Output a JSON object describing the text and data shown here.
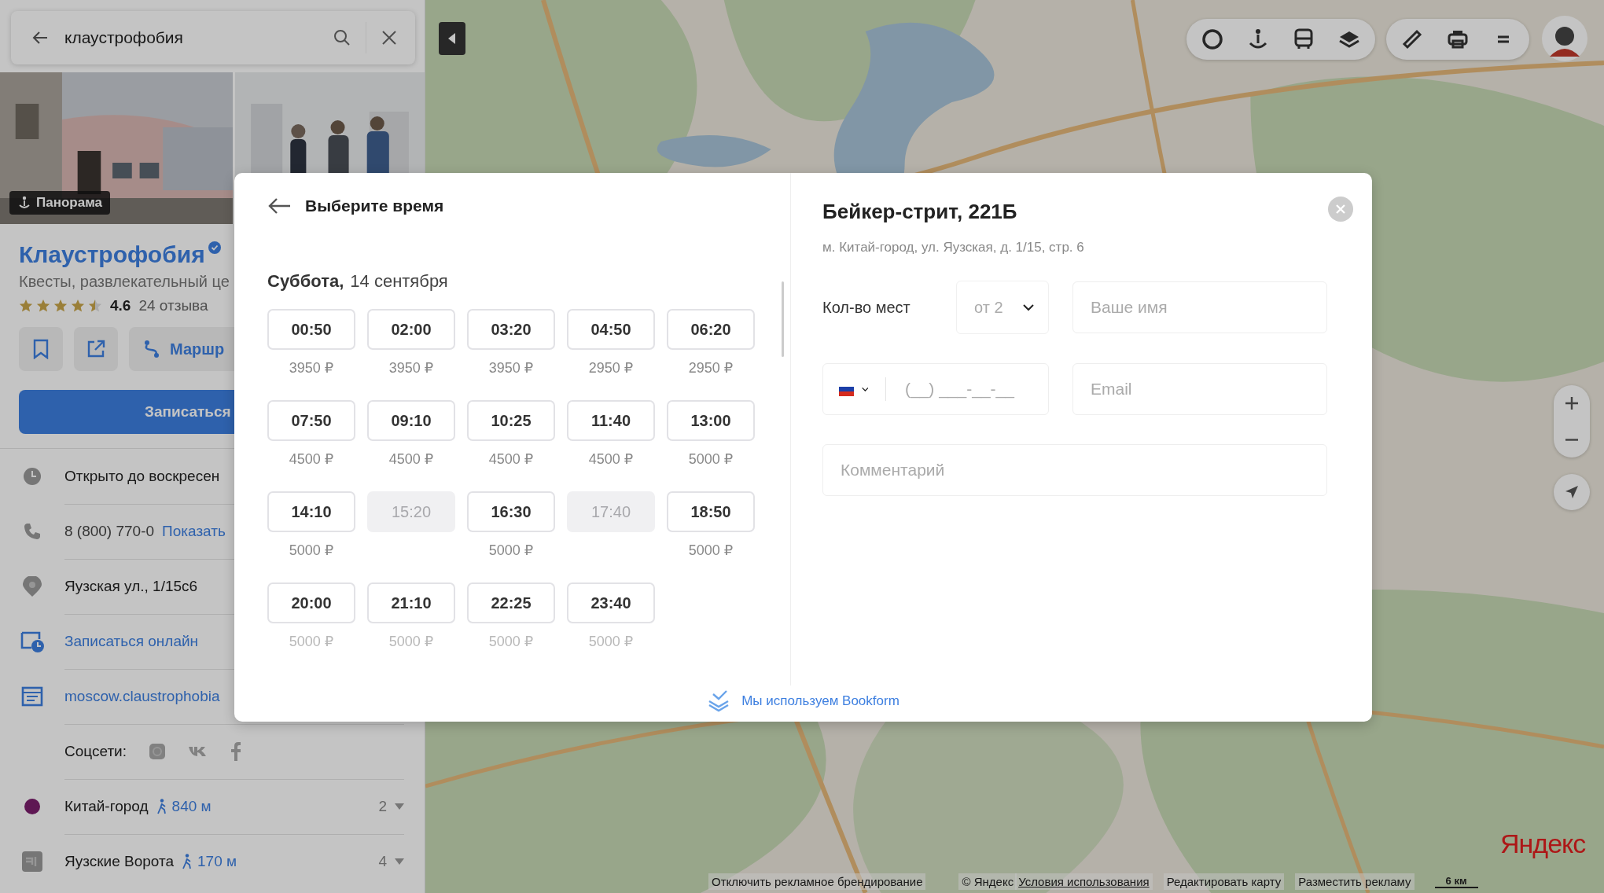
{
  "search": {
    "value": "клаустрофобия"
  },
  "place": {
    "panorama_label": "Панорама",
    "name": "Клаустрофобия",
    "verified": true,
    "category": "Квесты, развлекательный це",
    "rating": {
      "stars": 4.5,
      "value": "4.6",
      "reviews": "24 отзыва"
    },
    "route_label": "Маршр",
    "book_label": "Записаться"
  },
  "info_rows": [
    {
      "kind": "hours",
      "text": "Открыто до воскресен"
    },
    {
      "kind": "phone",
      "text": "8 (800) 770-0",
      "link": "Показать"
    },
    {
      "kind": "address",
      "text": "Яузская ул., 1/15с6"
    },
    {
      "kind": "booking",
      "link": "Записаться онлайн"
    },
    {
      "kind": "website",
      "link": "moscow.claustrophobia"
    },
    {
      "kind": "socials",
      "text": "Соцсети:"
    }
  ],
  "metro": [
    {
      "kind": "metro",
      "name": "Китай-город",
      "color": "#5e1753",
      "distance": "840 м",
      "count": "2"
    },
    {
      "kind": "station",
      "name": "Яузские Ворота",
      "distance": "170 м",
      "count": "4"
    }
  ],
  "booking": {
    "title": "Выберите время",
    "day": "Суббота,",
    "date": "14 сентября",
    "slots": [
      {
        "time": "00:50",
        "price": "3950 ₽",
        "disabled": false
      },
      {
        "time": "02:00",
        "price": "3950 ₽",
        "disabled": false
      },
      {
        "time": "03:20",
        "price": "3950 ₽",
        "disabled": false
      },
      {
        "time": "04:50",
        "price": "2950 ₽",
        "disabled": false
      },
      {
        "time": "06:20",
        "price": "2950 ₽",
        "disabled": false
      },
      {
        "time": "07:50",
        "price": "4500 ₽",
        "disabled": false
      },
      {
        "time": "09:10",
        "price": "4500 ₽",
        "disabled": false
      },
      {
        "time": "10:25",
        "price": "4500 ₽",
        "disabled": false
      },
      {
        "time": "11:40",
        "price": "4500 ₽",
        "disabled": false
      },
      {
        "time": "13:00",
        "price": "5000 ₽",
        "disabled": false
      },
      {
        "time": "14:10",
        "price": "5000 ₽",
        "disabled": false
      },
      {
        "time": "15:20",
        "disabled": true
      },
      {
        "time": "16:30",
        "price": "5000 ₽",
        "disabled": false
      },
      {
        "time": "17:40",
        "disabled": true
      },
      {
        "time": "18:50",
        "price": "5000 ₽",
        "disabled": false
      },
      {
        "time": "20:00",
        "price": "5000 ₽",
        "disabled": false
      },
      {
        "time": "21:10",
        "price": "5000 ₽",
        "disabled": false
      },
      {
        "time": "22:25",
        "price": "5000 ₽",
        "disabled": false
      },
      {
        "time": "23:40",
        "price": "5000 ₽",
        "disabled": false
      }
    ],
    "venue": "Бейкер-стрит, 221Б",
    "address": "м. Китай-город, ул. Яузская, д. 1/15, стр. 6",
    "seats_label": "Кол-во мест",
    "seats_value": "от 2",
    "name_placeholder": "Ваше имя",
    "phone_placeholder": "(__) ___-__-__",
    "email_placeholder": "Email",
    "comment_placeholder": "Комментарий",
    "powered_by": "Мы используем Bookform"
  },
  "map_footer": {
    "links": [
      "Отключить рекламное брендирование"
    ],
    "copyright": "© Яндекс",
    "terms": "Условия использования",
    "more_links": [
      "Редактировать карту",
      "Разместить рекламу"
    ],
    "logo": "Яндекс",
    "scale": "6 км"
  }
}
